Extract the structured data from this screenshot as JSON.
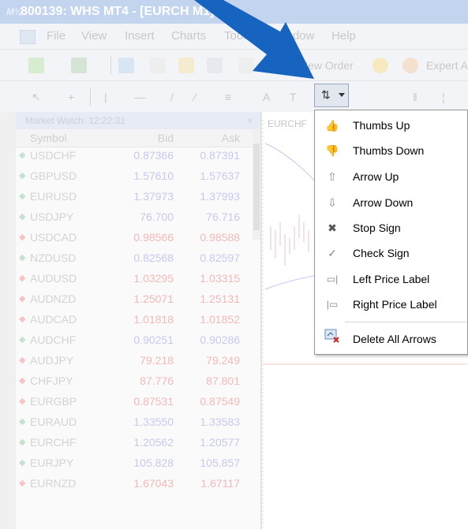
{
  "window": {
    "title": "800139: WHS MT4 - [EURCH M1]"
  },
  "menu": [
    "File",
    "View",
    "Insert",
    "Charts",
    "Tools",
    "Window",
    "Help"
  ],
  "toolbar": {
    "new_order": "New Order",
    "expert": "Expert A"
  },
  "market_watch": {
    "title": "Market Watch: 12:22:31",
    "close": "×",
    "columns": {
      "symbol": "Symbol",
      "bid": "Bid",
      "ask": "Ask"
    },
    "rows": [
      {
        "symbol": "USDCHF",
        "bid": "0.87366",
        "ask": "0.87391",
        "dir": "up"
      },
      {
        "symbol": "GBPUSD",
        "bid": "1.57610",
        "ask": "1.57637",
        "dir": "up"
      },
      {
        "symbol": "EURUSD",
        "bid": "1.37973",
        "ask": "1.37993",
        "dir": "up"
      },
      {
        "symbol": "USDJPY",
        "bid": "76.700",
        "ask": "76.716",
        "dir": "up"
      },
      {
        "symbol": "USDCAD",
        "bid": "0.98566",
        "ask": "0.98588",
        "dir": "down"
      },
      {
        "symbol": "NZDUSD",
        "bid": "0.82568",
        "ask": "0.82597",
        "dir": "up"
      },
      {
        "symbol": "AUDUSD",
        "bid": "1.03295",
        "ask": "1.03315",
        "dir": "down"
      },
      {
        "symbol": "AUDNZD",
        "bid": "1.25071",
        "ask": "1.25131",
        "dir": "down"
      },
      {
        "symbol": "AUDCAD",
        "bid": "1.01818",
        "ask": "1.01852",
        "dir": "down"
      },
      {
        "symbol": "AUDCHF",
        "bid": "0.90251",
        "ask": "0.90286",
        "dir": "up"
      },
      {
        "symbol": "AUDJPY",
        "bid": "79.218",
        "ask": "79.249",
        "dir": "down"
      },
      {
        "symbol": "CHFJPY",
        "bid": "87.776",
        "ask": "87.801",
        "dir": "down"
      },
      {
        "symbol": "EURGBP",
        "bid": "0.87531",
        "ask": "0.87549",
        "dir": "down"
      },
      {
        "symbol": "EURAUD",
        "bid": "1.33550",
        "ask": "1.33583",
        "dir": "up"
      },
      {
        "symbol": "EURCHF",
        "bid": "1.20562",
        "ask": "1.20577",
        "dir": "up"
      },
      {
        "symbol": "EURJPY",
        "bid": "105.828",
        "ask": "105.857",
        "dir": "up"
      },
      {
        "symbol": "EURNZD",
        "bid": "1.67043",
        "ask": "1.67117",
        "dir": "down"
      }
    ]
  },
  "chart": {
    "tab": "EURCHF"
  },
  "arrows_menu": {
    "items": [
      {
        "label": "Thumbs Up",
        "icon": "thumbs-up-icon"
      },
      {
        "label": "Thumbs Down",
        "icon": "thumbs-down-icon"
      },
      {
        "label": "Arrow Up",
        "icon": "arrow-up-icon"
      },
      {
        "label": "Arrow Down",
        "icon": "arrow-down-icon"
      },
      {
        "label": "Stop Sign",
        "icon": "stop-sign-icon"
      },
      {
        "label": "Check Sign",
        "icon": "check-sign-icon"
      },
      {
        "label": "Left Price Label",
        "icon": "left-price-label-icon"
      },
      {
        "label": "Right Price Label",
        "icon": "right-price-label-icon"
      },
      {
        "label": "Delete All Arrows",
        "icon": "delete-arrows-icon"
      }
    ]
  },
  "colors": {
    "annotation_arrow": "#1764c0",
    "titlebar": "#c3d4ee",
    "up": "#c3e3cf",
    "down": "#f6c4c4"
  }
}
